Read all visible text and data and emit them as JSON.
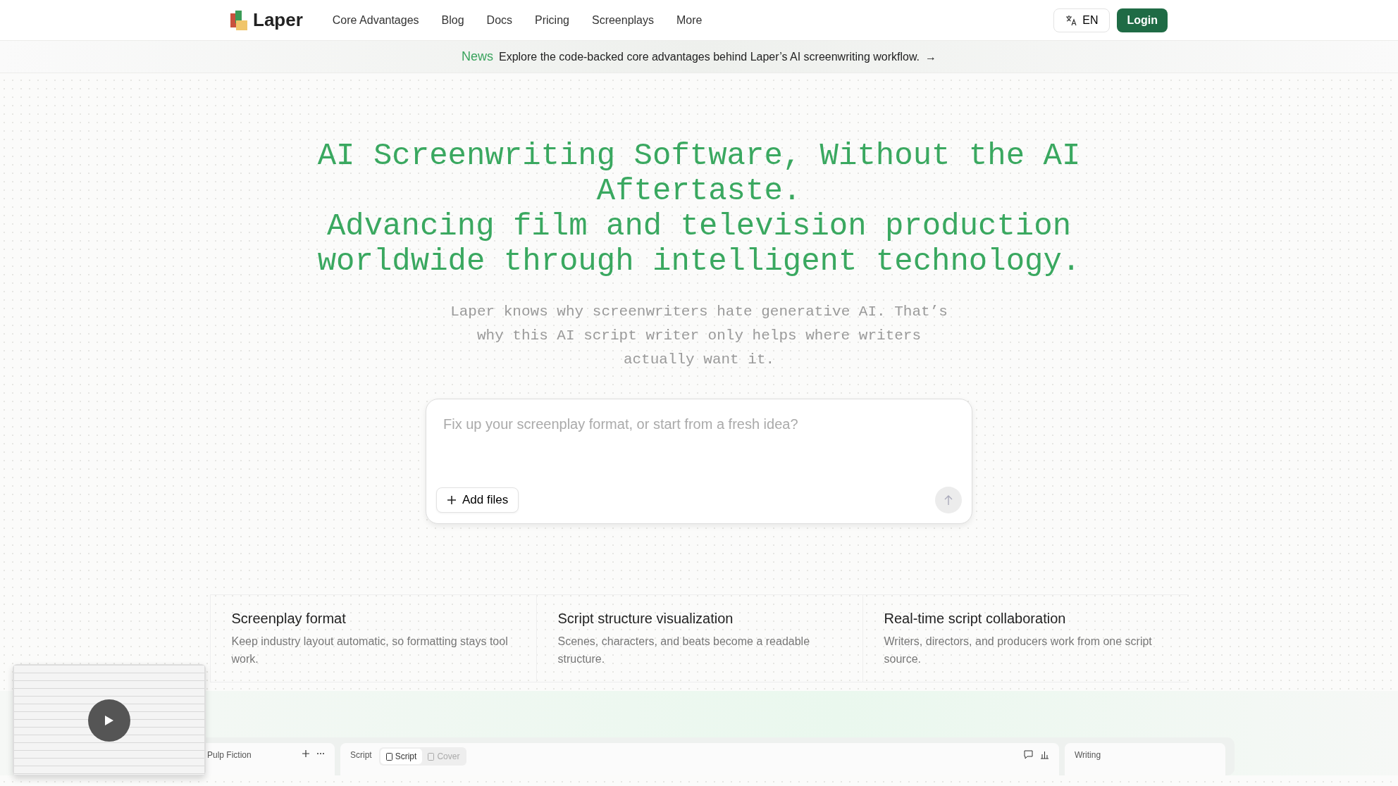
{
  "nav": {
    "logo": "Laper",
    "links": [
      "Core Advantages",
      "Blog",
      "Docs",
      "Pricing",
      "Screenplays",
      "More"
    ],
    "language": "EN",
    "login": "Login"
  },
  "news": {
    "tag": "News",
    "text": "Explore the code-backed core advantages behind Laper’s AI screenwriting workflow.",
    "arrow": "→"
  },
  "hero": {
    "title_lines": [
      "AI Screenwriting Software, Without the AI Aftertaste.",
      "Advancing film and television production worldwide through intelligent technology."
    ],
    "subtitle": "Laper knows why screenwriters hate generative AI. That’s why this AI script writer only helps where writers actually want it."
  },
  "prompt": {
    "placeholder": "Fix up your screenplay format, or start from a fresh idea?",
    "add_files": "Add files"
  },
  "features": [
    {
      "title": "Screenplay format",
      "description": "Keep industry layout automatic, so formatting stays tool work."
    },
    {
      "title": "Script structure visualization",
      "description": "Scenes, characters, and beats become a readable structure."
    },
    {
      "title": "Real-time script collaboration",
      "description": "Writers, directors, and producers work from one script source."
    }
  ],
  "app_preview": {
    "files_panel": {
      "title": "Pulp Fiction"
    },
    "script_panel": {
      "title": "Script",
      "tabs": [
        {
          "label": "Script",
          "selected": true
        },
        {
          "label": "Cover",
          "selected": false
        }
      ]
    },
    "writing_panel": {
      "title": "Writing"
    }
  }
}
